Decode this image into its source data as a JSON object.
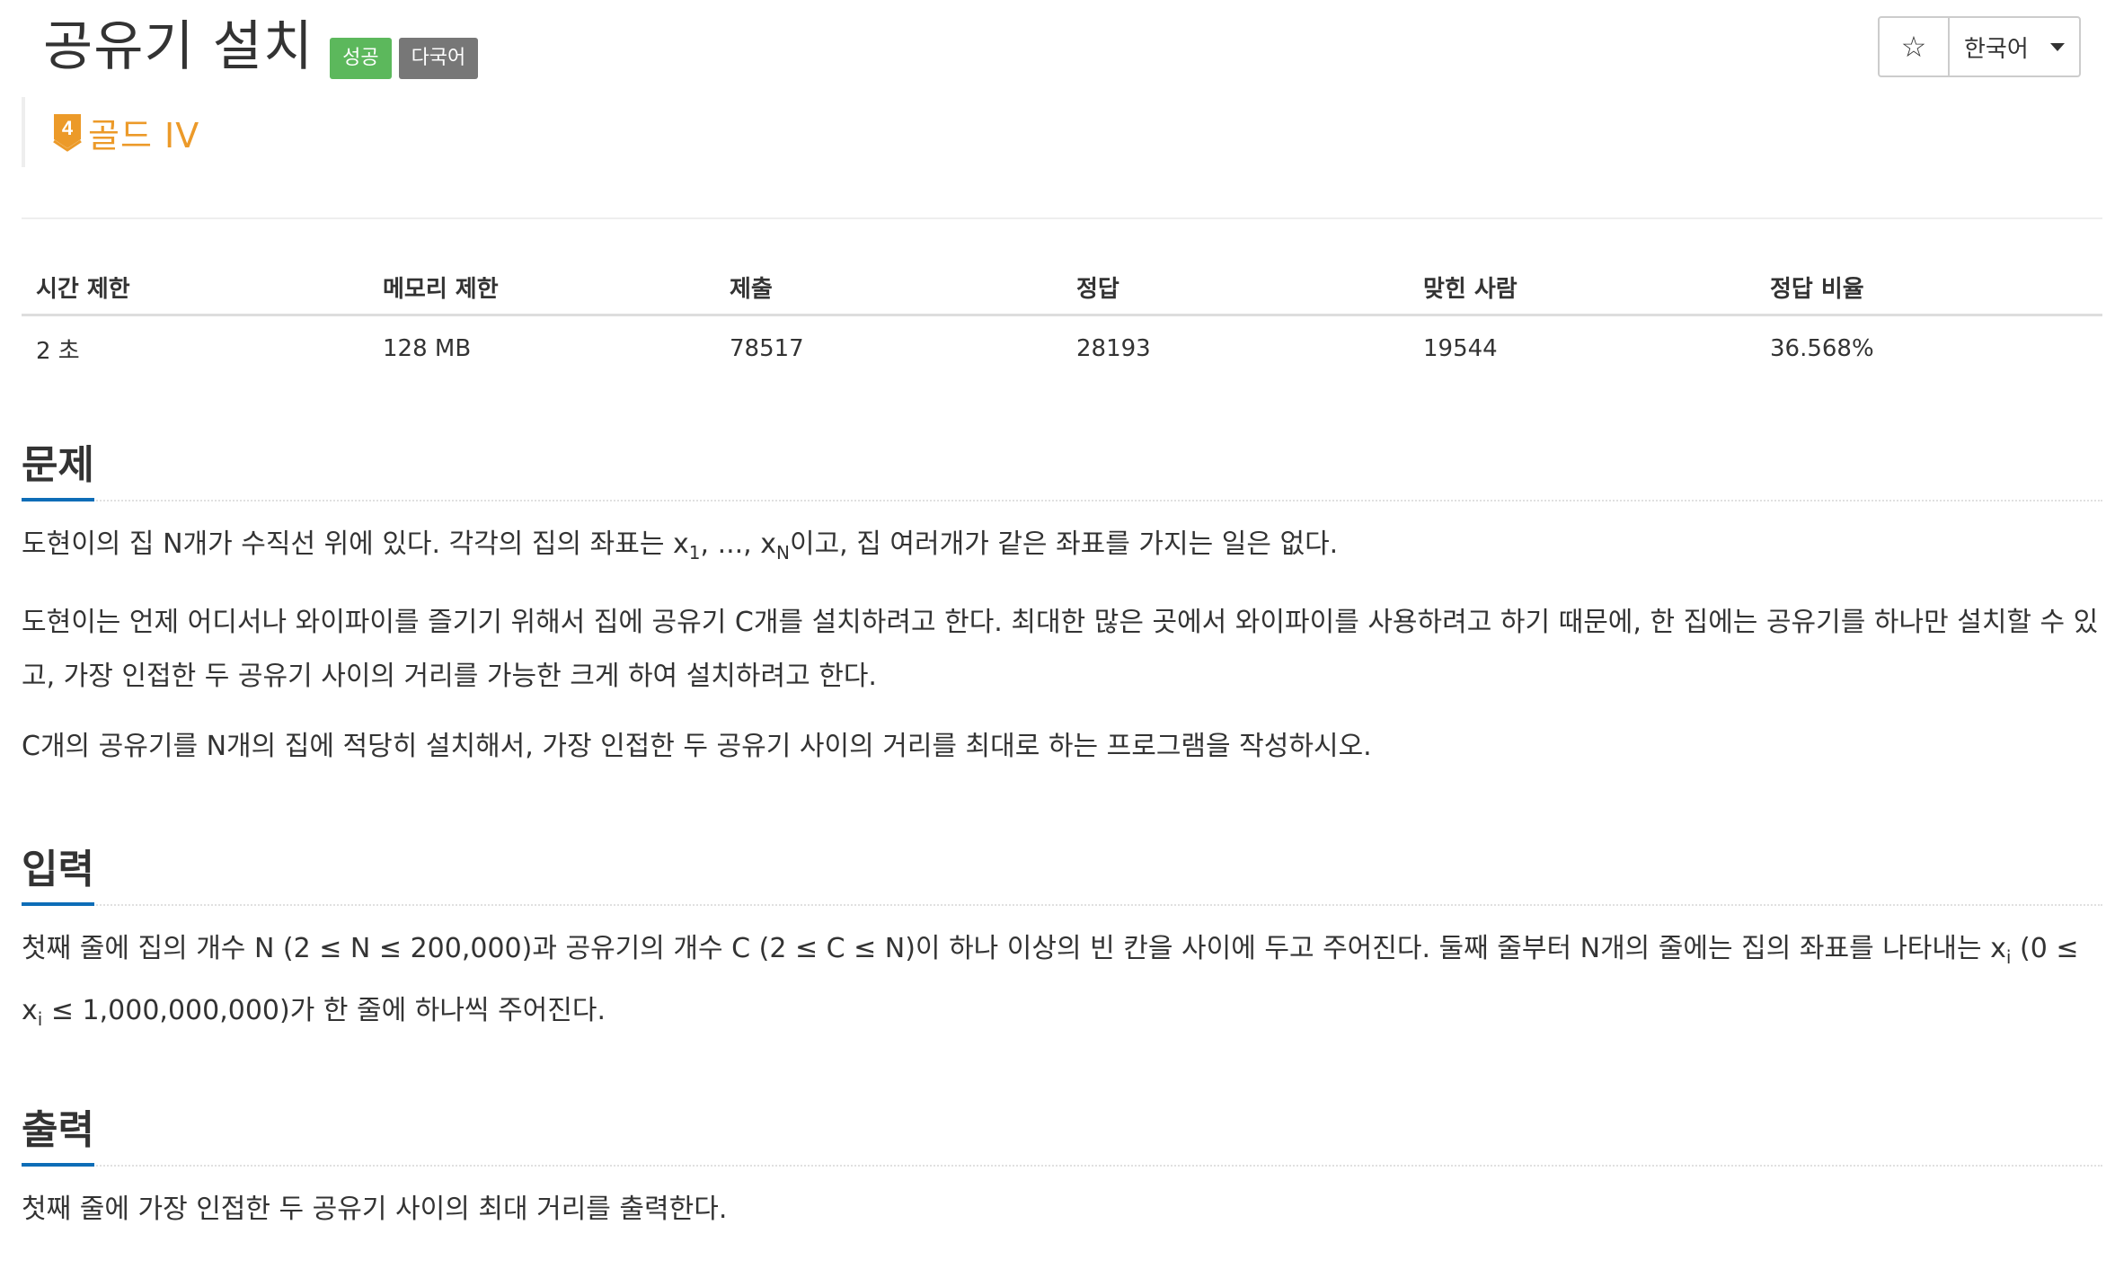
{
  "problem": {
    "title": "공유기 설치",
    "badges": {
      "success": "성공",
      "multilang": "다국어"
    },
    "tier": {
      "number": "4",
      "label": "골드 IV",
      "color": "#ec9a29"
    }
  },
  "toolbar": {
    "star_label": "☆",
    "language": "한국어"
  },
  "stats": {
    "headers": [
      "시간 제한",
      "메모리 제한",
      "제출",
      "정답",
      "맞힌 사람",
      "정답 비율"
    ],
    "values": [
      "2 초",
      "128 MB",
      "78517",
      "28193",
      "19544",
      "36.568%"
    ]
  },
  "sections": {
    "problem": {
      "title": "문제",
      "p1_a": "도현이의 집 N개가 수직선 위에 있다. 각각의 집의 좌표는 x",
      "p1_sub1": "1",
      "p1_b": ", ..., x",
      "p1_subN": "N",
      "p1_c": "이고, 집 여러개가 같은 좌표를 가지는 일은 없다.",
      "p2": "도현이는 언제 어디서나 와이파이를 즐기기 위해서 집에 공유기 C개를 설치하려고 한다. 최대한 많은 곳에서 와이파이를 사용하려고 하기 때문에, 한 집에는 공유기를 하나만 설치할 수 있고, 가장 인접한 두 공유기 사이의 거리를 가능한 크게 하여 설치하려고 한다.",
      "p3": "C개의 공유기를 N개의 집에 적당히 설치해서, 가장 인접한 두 공유기 사이의 거리를 최대로 하는 프로그램을 작성하시오."
    },
    "input": {
      "title": "입력",
      "p1_a": "첫째 줄에 집의 개수 N (2 ≤ N ≤ 200,000)과 공유기의 개수 C (2 ≤ C ≤ N)이 하나 이상의 빈 칸을 사이에 두고 주어진다. 둘째 줄부터 N개의 줄에는 집의 좌표를 나타내는 x",
      "p1_sub1": "i",
      "p1_b": " (0 ≤ x",
      "p1_sub2": "i",
      "p1_c": " ≤ 1,000,000,000)가 한 줄에 하나씩 주어진다."
    },
    "output": {
      "title": "출력",
      "p1": "첫째 줄에 가장 인접한 두 공유기 사이의 최대 거리를 출력한다."
    }
  }
}
